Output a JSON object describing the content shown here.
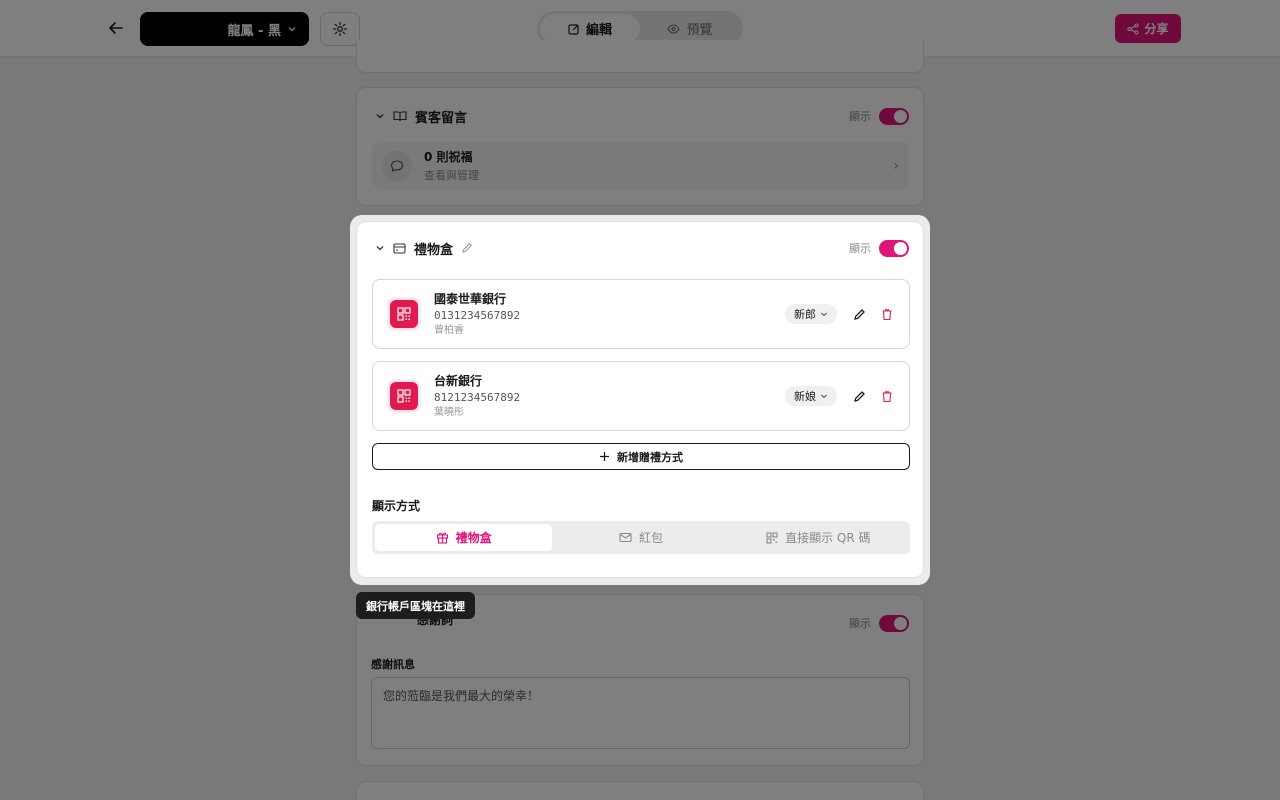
{
  "topbar": {
    "site_name": "龍鳳 - 黑",
    "mode_edit": "編輯",
    "mode_preview": "預覽",
    "share_label": "分享"
  },
  "guestbook": {
    "title": "賓客留言",
    "show_label": "顯示",
    "count_text": "0 則祝福",
    "sub_text": "查看與管理"
  },
  "gift": {
    "title": "禮物盒",
    "show_label": "顯示",
    "banks": [
      {
        "name": "國泰世華銀行",
        "account": "0131234567892",
        "holder": "曾柏睿",
        "role": "新郎"
      },
      {
        "name": "台新銀行",
        "account": "8121234567892",
        "holder": "葉曉彤",
        "role": "新娘"
      }
    ],
    "add_label": "新增贈禮方式",
    "display_title": "顯示方式",
    "display_options": [
      "禮物盒",
      "紅包",
      "直接顯示 QR 碼"
    ]
  },
  "tooltip": "銀行帳戶區塊在這裡",
  "thanks": {
    "title": "感謝詞",
    "show_label": "顯示",
    "message_label": "感謝訊息",
    "message_value": "您的蒞臨是我們最大的榮幸！"
  },
  "colors": {
    "accent": "#e0157a",
    "qr_red": "#e0194f"
  }
}
